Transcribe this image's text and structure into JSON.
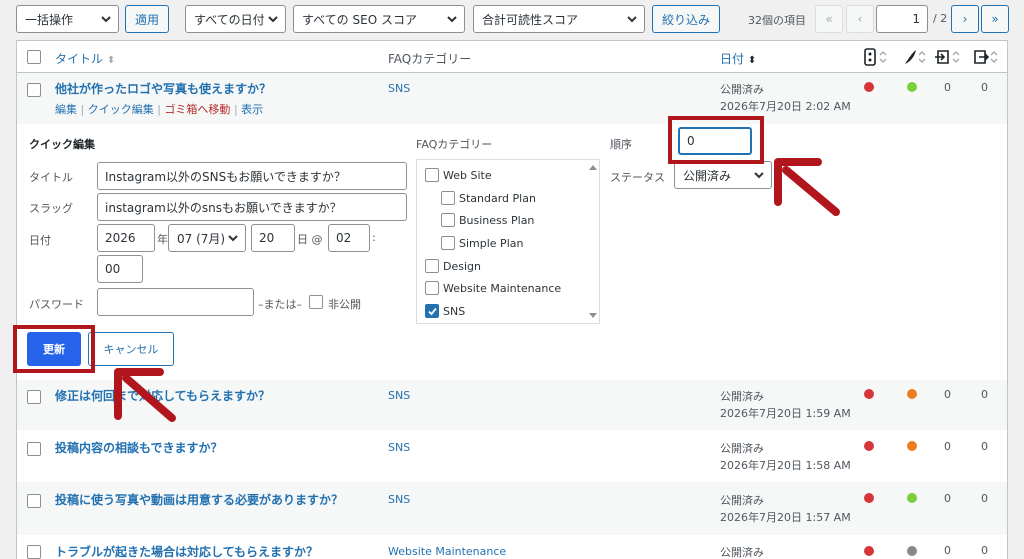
{
  "toolbar": {
    "bulk_action": "一括操作",
    "apply": "適用",
    "date_filter": "すべての日付",
    "seo_filter": "すべての SEO スコア",
    "readability_filter": "合計可読性スコア",
    "filter_button": "絞り込み",
    "items_count": "32個の項目",
    "first_page": "«",
    "prev_page": "‹",
    "current_page": "1",
    "total_pages": "/ 2",
    "next_page": "›",
    "last_page": "»"
  },
  "table": {
    "col_title": "タイトル",
    "col_faq_category": "FAQカテゴリー",
    "col_date": "日付",
    "rows": [
      {
        "title": "他社が作ったロゴや写真も使えますか？",
        "category": "SNS",
        "status": "公開済み",
        "date": "2026年7月20日 2:02 AM",
        "seo_color": "#d63638",
        "read_color": "#7ad03a",
        "c1": "0",
        "c2": "0",
        "actions": {
          "edit": "編集",
          "quick_edit": "クイック編集",
          "trash": "ゴミ箱へ移動",
          "view": "表示",
          "sep": "|"
        }
      },
      {
        "title": "修正は何回まで対応してもらえますか？",
        "category": "SNS",
        "status": "公開済み",
        "date": "2026年7月20日 1:59 AM",
        "seo_color": "#d63638",
        "read_color": "#ee7c1b",
        "c1": "0",
        "c2": "0"
      },
      {
        "title": "投稿内容の相談もできますか？",
        "category": "SNS",
        "status": "公開済み",
        "date": "2026年7月20日 1:58 AM",
        "seo_color": "#d63638",
        "read_color": "#ee7c1b",
        "c1": "0",
        "c2": "0"
      },
      {
        "title": "投稿に使う写真や動画は用意する必要がありますか？",
        "category": "SNS",
        "status": "公開済み",
        "date": "2026年7月20日 1:57 AM",
        "seo_color": "#d63638",
        "read_color": "#7ad03a",
        "c1": "0",
        "c2": "0"
      },
      {
        "title": "トラブルが起きた場合は対応してもらえますか？",
        "category": "Website Maintenance",
        "status": "公開済み",
        "date": "",
        "seo_color": "#d63638",
        "read_color": "#888888",
        "c1": "0",
        "c2": "0"
      }
    ]
  },
  "quick_edit": {
    "heading": "クイック編集",
    "title_label": "タイトル",
    "title_value": "Instagram以外のSNSもお願いできますか？",
    "slug_label": "スラッグ",
    "slug_value": "instagram以外のsnsもお願いできますか？",
    "date_label": "日付",
    "year": "2026",
    "year_unit": "年",
    "month": "07 (7月)",
    "day": "20",
    "day_unit": "日 @",
    "hour": "02",
    "colon": ":",
    "minute": "00",
    "password_label": "パスワード",
    "or_text": "–または–",
    "private_label": "非公開",
    "faq_category_label": "FAQカテゴリー",
    "categories": [
      {
        "name": "Web Site",
        "checked": false,
        "indent": false
      },
      {
        "name": "Standard Plan",
        "checked": false,
        "indent": true
      },
      {
        "name": "Business Plan",
        "checked": false,
        "indent": true
      },
      {
        "name": "Simple Plan",
        "checked": false,
        "indent": true
      },
      {
        "name": "Design",
        "checked": false,
        "indent": false
      },
      {
        "name": "Website Maintenance",
        "checked": false,
        "indent": false
      },
      {
        "name": "SNS",
        "checked": true,
        "indent": false
      }
    ],
    "order_label": "順序",
    "order_value": "0",
    "status_label": "ステータス",
    "status_value": "公開済み",
    "update_button": "更新",
    "cancel_button": "キャンセル"
  },
  "colors": {
    "accent": "#2271b1",
    "primary_button": "#2563eb",
    "annotation": "#b2161d"
  }
}
